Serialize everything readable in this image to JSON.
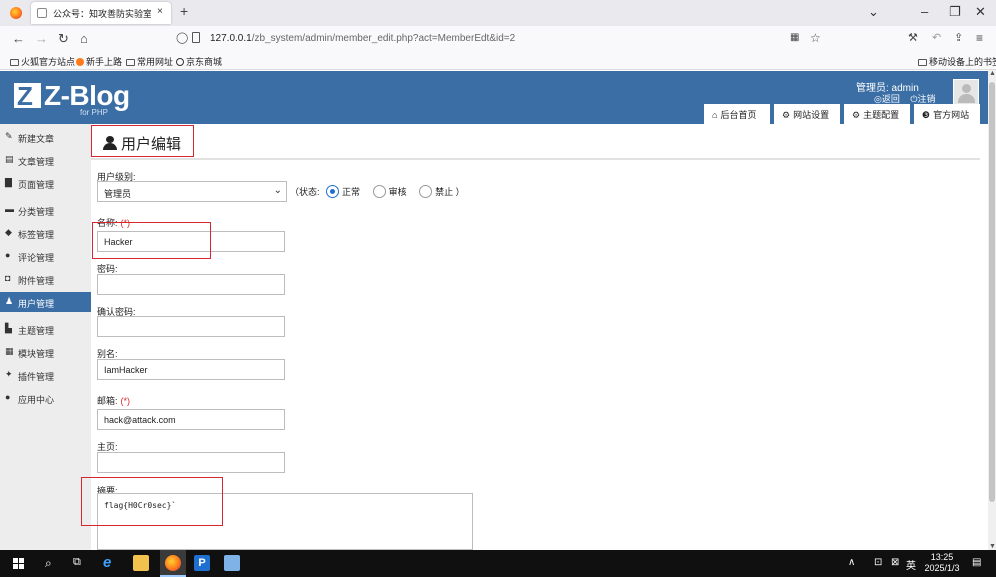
{
  "browser": {
    "tab_title": "公众号：知攻善防实验室 - 用户编辑",
    "tab_close": "×",
    "new_tab": "+",
    "url_host": "127.0.0.1",
    "url_rest": "/zb_system/admin/member_edit.php?act=MemberEdt&id=2",
    "bookmarks": [
      "火狐官方站点",
      "新手上路",
      "常用网址",
      "京东商城"
    ],
    "mobile_bookmarks": "移动设备上的书签"
  },
  "header": {
    "logo_letter": "Z",
    "logo_text": "Z-Blog",
    "logo_sub": "for PHP",
    "admin_label": "管理员: admin",
    "back_link": "返回",
    "logout_link": "注销",
    "nav": [
      "后台首页",
      "网站设置",
      "主题配置",
      "官方网站"
    ]
  },
  "sidebar": {
    "items": [
      {
        "label": "新建文章",
        "icon": "edit-icon"
      },
      {
        "label": "文章管理",
        "icon": "article-icon"
      },
      {
        "label": "页面管理",
        "icon": "page-icon"
      },
      {
        "label": "分类管理",
        "icon": "folder-icon"
      },
      {
        "label": "标签管理",
        "icon": "tag-icon"
      },
      {
        "label": "评论管理",
        "icon": "comment-icon"
      },
      {
        "label": "附件管理",
        "icon": "attachment-icon"
      },
      {
        "label": "用户管理",
        "icon": "users-icon",
        "active": true
      },
      {
        "label": "主题管理",
        "icon": "theme-icon"
      },
      {
        "label": "模块管理",
        "icon": "module-icon"
      },
      {
        "label": "插件管理",
        "icon": "plugin-icon"
      },
      {
        "label": "应用中心",
        "icon": "app-center-icon"
      }
    ]
  },
  "main": {
    "title": "用户编辑",
    "level_label": "用户级别:",
    "level_value": "管理员",
    "status_label": "（状态:",
    "status_options": [
      "正常",
      "审核",
      "禁止"
    ],
    "status_close": "）",
    "status_selected": "正常",
    "name_label": "名称:",
    "name_value": "Hacker",
    "password_label": "密码:",
    "password_value": "",
    "confirm_label": "确认密码:",
    "confirm_value": "",
    "alias_label": "别名:",
    "alias_value": "IamHacker",
    "email_label": "邮箱:",
    "email_value": "hack@attack.com",
    "homepage_label": "主页:",
    "homepage_value": "",
    "summary_label": "摘要:",
    "summary_value": "flag{H0Cr0sec}`",
    "required_mark": "(*)"
  },
  "taskbar": {
    "time": "13:25",
    "date": "2025/1/3",
    "ime": "英"
  }
}
